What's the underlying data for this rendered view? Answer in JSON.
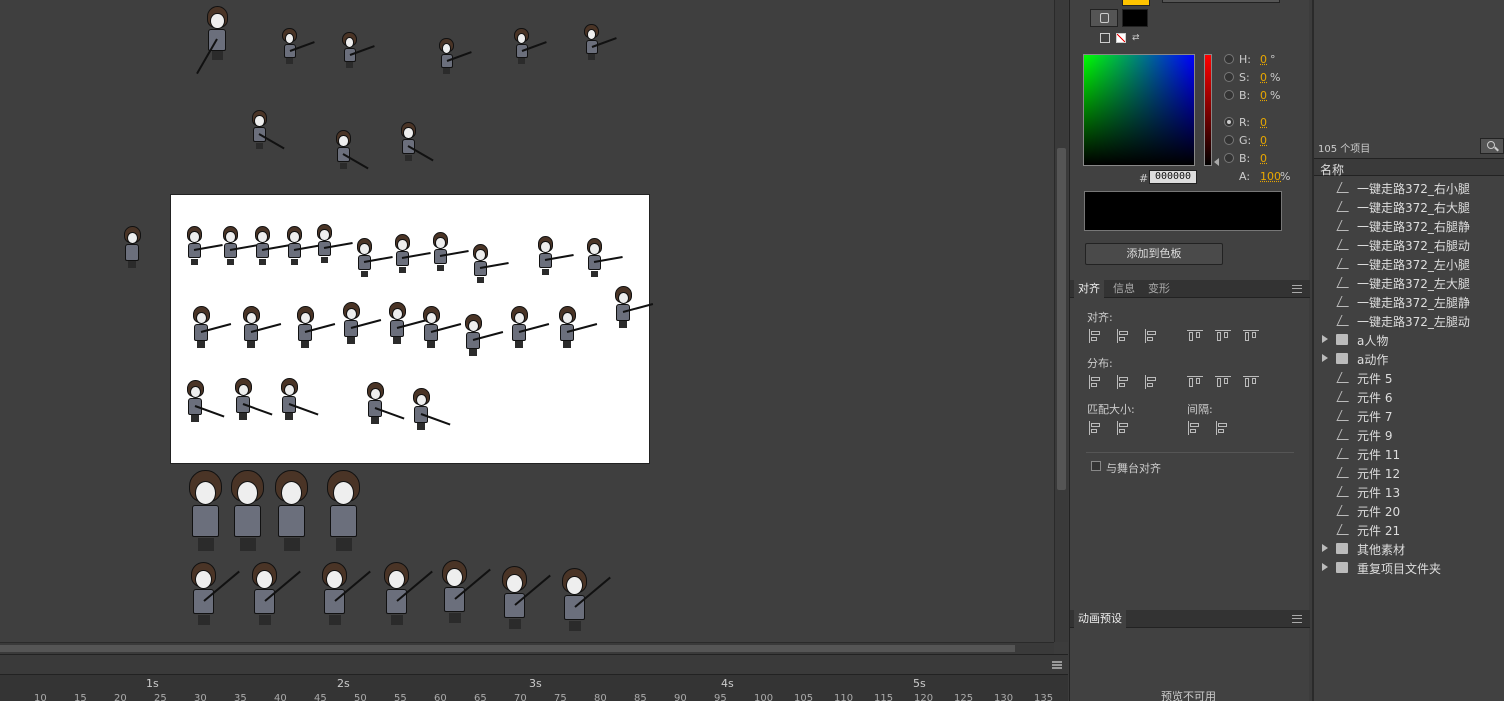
{
  "colors": {
    "fill_swatch": "#ffc400",
    "stroke_swatch": "#000000",
    "accent_value": "#e8a700"
  },
  "color_panel": {
    "fields": [
      {
        "label": "H:",
        "value": "0",
        "unit": "°"
      },
      {
        "label": "S:",
        "value": "0",
        "unit": "%"
      },
      {
        "label": "B:",
        "value": "0",
        "unit": "%"
      },
      {
        "label": "R:",
        "value": "0",
        "unit": ""
      },
      {
        "label": "G:",
        "value": "0",
        "unit": ""
      },
      {
        "label": "B:",
        "value": "0",
        "unit": ""
      },
      {
        "label": "A:",
        "value": "100",
        "unit": "%"
      }
    ],
    "hex_label": "#",
    "hex_value": "000000",
    "add_button": "添加到色板"
  },
  "align_panel": {
    "tabs": [
      "对齐",
      "信息",
      "变形"
    ],
    "align_label": "对齐:",
    "distribute_label": "分布:",
    "match_size_label": "匹配大小:",
    "spacing_label": "间隔:",
    "stage_checkbox_label": "与舞台对齐"
  },
  "anim_panel": {
    "title": "动画预设",
    "unavailable": "预览不可用"
  },
  "library": {
    "count": "105 个项目",
    "column_header": "名称",
    "items": [
      {
        "label": "一键走路372_右小腿",
        "kind": "symbol"
      },
      {
        "label": "一键走路372_右大腿",
        "kind": "symbol"
      },
      {
        "label": "一键走路372_右腿静",
        "kind": "symbol"
      },
      {
        "label": "一键走路372_右腿动",
        "kind": "symbol"
      },
      {
        "label": "一键走路372_左小腿",
        "kind": "symbol"
      },
      {
        "label": "一键走路372_左大腿",
        "kind": "symbol"
      },
      {
        "label": "一键走路372_左腿静",
        "kind": "symbol"
      },
      {
        "label": "一键走路372_左腿动",
        "kind": "symbol"
      },
      {
        "label": "a人物",
        "kind": "folder"
      },
      {
        "label": "a动作",
        "kind": "folder"
      },
      {
        "label": "元件 5",
        "kind": "symbol"
      },
      {
        "label": "元件 6",
        "kind": "symbol"
      },
      {
        "label": "元件 7",
        "kind": "symbol"
      },
      {
        "label": "元件 9",
        "kind": "symbol"
      },
      {
        "label": "元件 11",
        "kind": "symbol"
      },
      {
        "label": "元件 12",
        "kind": "symbol"
      },
      {
        "label": "元件 13",
        "kind": "symbol"
      },
      {
        "label": "元件 20",
        "kind": "symbol"
      },
      {
        "label": "元件 21",
        "kind": "symbol"
      },
      {
        "label": "其他素材",
        "kind": "folder"
      },
      {
        "label": "重复项目文件夹",
        "kind": "folder"
      }
    ]
  },
  "timeline": {
    "seconds": [
      "1s",
      "2s",
      "3s",
      "4s",
      "5s"
    ],
    "frames": [
      "10",
      "15",
      "20",
      "25",
      "30",
      "35",
      "40",
      "45",
      "50",
      "55",
      "60",
      "65",
      "70",
      "75",
      "80",
      "85",
      "90",
      "95",
      "100",
      "105",
      "110",
      "115",
      "120",
      "125",
      "130",
      "135"
    ]
  }
}
